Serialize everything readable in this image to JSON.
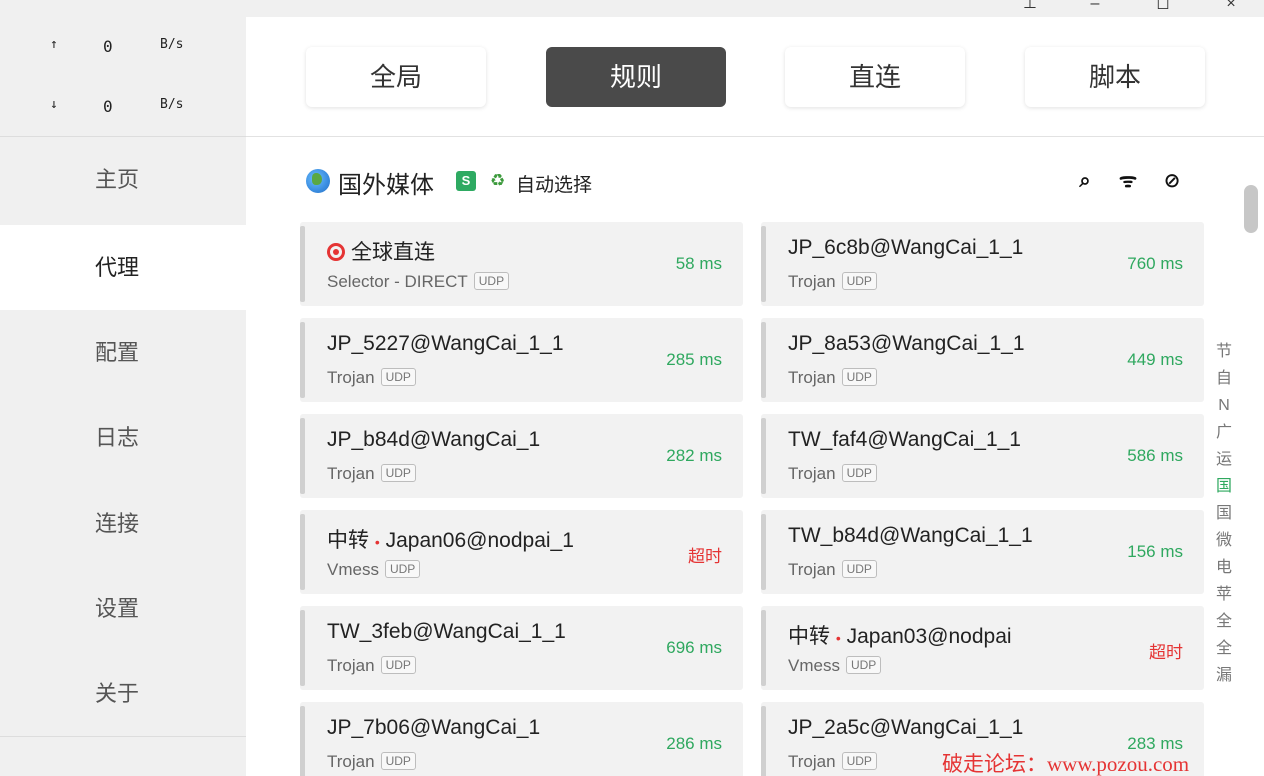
{
  "window_controls": {
    "pin": "⊥",
    "min": "–",
    "max": "◻",
    "close": "×"
  },
  "traffic": {
    "up": {
      "arrow": "↑",
      "value": "0",
      "unit": "B/s"
    },
    "down": {
      "arrow": "↓",
      "value": "0",
      "unit": "B/s"
    }
  },
  "nav": {
    "items": [
      {
        "label": "主页"
      },
      {
        "label": "代理"
      },
      {
        "label": "配置"
      },
      {
        "label": "日志"
      },
      {
        "label": "连接"
      },
      {
        "label": "设置"
      },
      {
        "label": "关于"
      }
    ],
    "active": "代理"
  },
  "modes": [
    {
      "label": "全局"
    },
    {
      "label": "规则"
    },
    {
      "label": "直连"
    },
    {
      "label": "脚本"
    }
  ],
  "active_mode": "规则",
  "group": {
    "icon": "globe-icon",
    "name": "国外媒体",
    "badge": "S",
    "auto_icon": "recycle-icon",
    "auto_label": "自动选择",
    "header_icons": [
      "search-delay-icon",
      "wifi-icon",
      "hide-icon"
    ]
  },
  "proxies": [
    {
      "name": "全球直连",
      "type": "Selector - DIRECT",
      "udp": "UDP",
      "delay": "58 ms"
    },
    {
      "name": "JP_6c8b@WangCai_1_1",
      "type": "Trojan",
      "udp": "UDP",
      "delay": "760 ms"
    },
    {
      "name": "JP_5227@WangCai_1_1",
      "type": "Trojan",
      "udp": "UDP",
      "delay": "285 ms"
    },
    {
      "name": "JP_8a53@WangCai_1_1",
      "type": "Trojan",
      "udp": "UDP",
      "delay": "449 ms"
    },
    {
      "name": "JP_b84d@WangCai_1",
      "type": "Trojan",
      "udp": "UDP",
      "delay": "282 ms"
    },
    {
      "name": "TW_faf4@WangCai_1_1",
      "type": "Trojan",
      "udp": "UDP",
      "delay": "586 ms"
    },
    {
      "name_prefix": "中转",
      "dot": "•",
      "name": "Japan06@nodpai_1",
      "type": "Vmess",
      "udp": "UDP",
      "delay": "超时"
    },
    {
      "name": "TW_b84d@WangCai_1_1",
      "type": "Trojan",
      "udp": "UDP",
      "delay": "156 ms"
    },
    {
      "name": "TW_3feb@WangCai_1_1",
      "type": "Trojan",
      "udp": "UDP",
      "delay": "696 ms"
    },
    {
      "name_prefix": "中转",
      "dot": "•",
      "name": "Japan03@nodpai",
      "type": "Vmess",
      "udp": "UDP",
      "delay": "超时"
    },
    {
      "name": "JP_7b06@WangCai_1",
      "type": "Trojan",
      "udp": "UDP",
      "delay": "286 ms"
    },
    {
      "name": "JP_2a5c@WangCai_1_1",
      "type": "Trojan",
      "udp": "UDP",
      "delay": "283 ms"
    }
  ],
  "side_strip": [
    "节",
    "自",
    "N",
    "广",
    "运",
    "国",
    "国",
    "微",
    "电",
    "苹",
    "全",
    "全",
    "漏"
  ],
  "colors": {
    "delay_ok": "#2fa85f",
    "delay_timeout": "#e53434",
    "active_mode_bg": "#4a4a4a"
  },
  "watermark": "破走论坛：www.pozou.com"
}
